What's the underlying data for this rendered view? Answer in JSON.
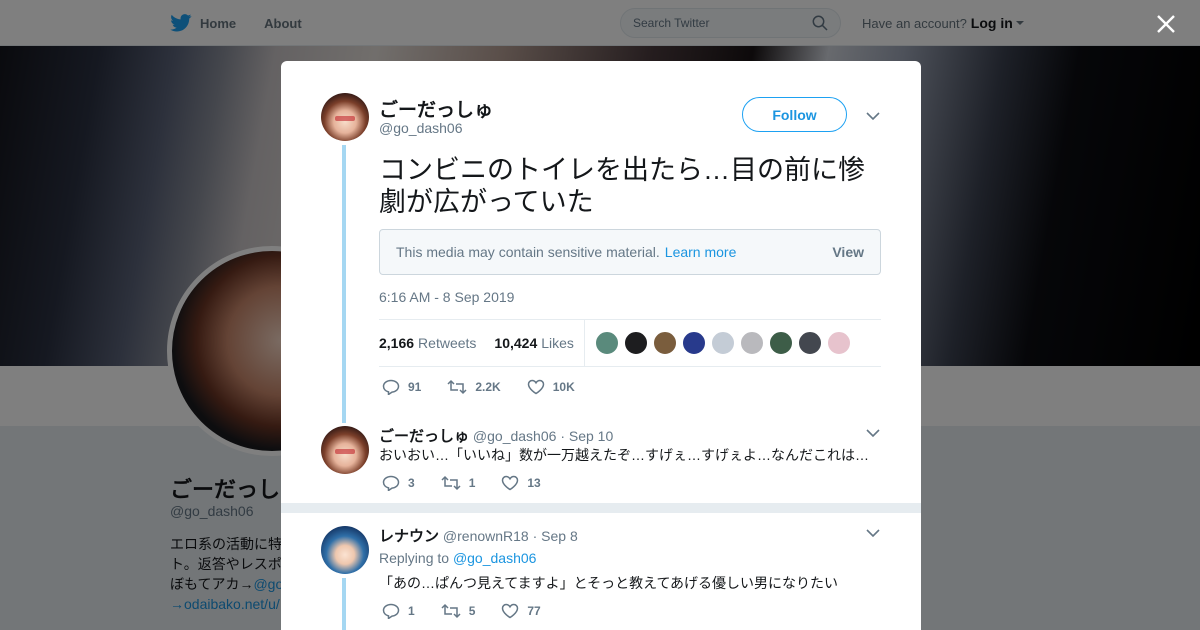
{
  "topbar": {
    "nav": [
      {
        "label": "Home"
      },
      {
        "label": "About"
      }
    ],
    "search_placeholder": "Search Twitter",
    "account_prompt": "Have an account?",
    "login_label": "Log in"
  },
  "profile": {
    "name": "ごーだっしゅ",
    "handle": "@go_dash06",
    "bio_lines": [
      "エロ系の活動に特",
      "ト。返答やレスポ",
      "ぼもてアカ→",
      "→odaibako.net/u/"
    ],
    "bio_link": "@go"
  },
  "tweet": {
    "author_name": "ごーだっしゅ",
    "author_handle": "@go_dash06",
    "follow_label": "Follow",
    "text": "コンビニのトイレを出たら…目の前に惨劇が広がっていた",
    "sensitive_text": "This media may contain sensitive material.",
    "learn_more": "Learn more",
    "view_label": "View",
    "timestamp": "6:16 AM - 8 Sep 2019",
    "retweets_count": "2,166",
    "retweets_label": "Retweets",
    "likes_count": "10,424",
    "likes_label": "Likes",
    "likers": [
      "#5a8a7c",
      "#1d1d1f",
      "#7a5d3d",
      "#283a8c",
      "#c4ccd6",
      "#b9b9bd",
      "#3d5d48",
      "#43474f",
      "#e7c3cd"
    ],
    "actions": {
      "replies": "91",
      "retweets": "2.2K",
      "likes": "10K"
    }
  },
  "replies": [
    {
      "name": "ごーだっしゅ",
      "handle": "@go_dash06",
      "date": "Sep 10",
      "text": "おいおい…「いいね」数が一万越えたぞ…すげぇ…すげぇよ…なんだこれは…",
      "actions": {
        "replies": "3",
        "retweets": "1",
        "likes": "13"
      }
    },
    {
      "name": "レナウン",
      "handle": "@renownR18",
      "date": "Sep 8",
      "replying_to_label": "Replying to",
      "replying_to": "@go_dash06",
      "text": "「あの…ぱんつ見えてますよ」とそっと教えてあげる優しい男になりたい",
      "actions": {
        "replies": "1",
        "retweets": "5",
        "likes": "77"
      }
    }
  ],
  "colors": {
    "accent": "#1da1f2",
    "link": "#1b95e0",
    "thread": "#a5d7f2",
    "muted": "#657786"
  }
}
